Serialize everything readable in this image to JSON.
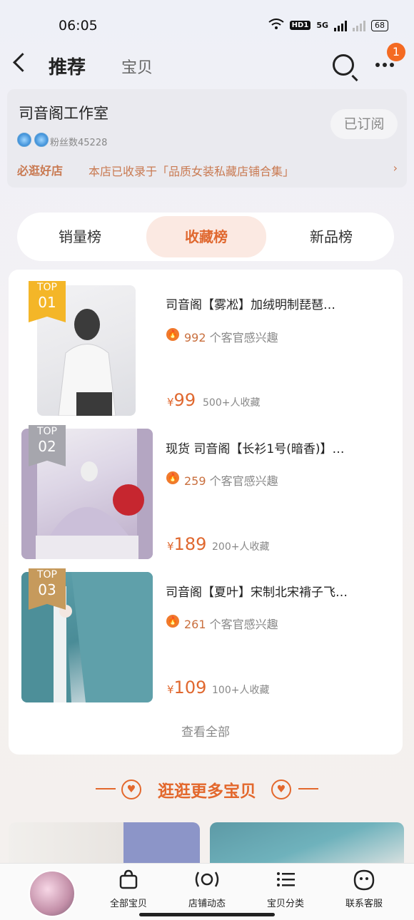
{
  "status": {
    "time": "06:05",
    "hd": "HD1",
    "net": "5G",
    "battery": "68"
  },
  "header": {
    "tab_active": "推荐",
    "tab_inactive": "宝贝",
    "badge": "1"
  },
  "shop": {
    "name": "司音阁工作室",
    "subscribe_label": "已订阅",
    "fans": "粉丝数45228",
    "must_tag": "必逛好店",
    "must_text": "本店已收录于「品质女装私藏店铺合集」",
    "arrow": "›"
  },
  "rank_tabs": [
    "销量榜",
    "收藏榜",
    "新品榜"
  ],
  "items": [
    {
      "top": "TOP",
      "rank": "01",
      "title": "司音阁【雾凇】加绒明制琵琶…",
      "interest_num": "992",
      "interest_text": "个客官感兴趣",
      "currency": "¥",
      "price": "99",
      "collect": "500+人收藏"
    },
    {
      "top": "TOP",
      "rank": "02",
      "title": "现货 司音阁【长衫1号(暗香)】…",
      "interest_num": "259",
      "interest_text": "个客官感兴趣",
      "currency": "¥",
      "price": "189",
      "collect": "200+人收藏"
    },
    {
      "top": "TOP",
      "rank": "03",
      "title": "司音阁【夏叶】宋制北宋褙子飞…",
      "interest_num": "261",
      "interest_text": "个客官感兴趣",
      "currency": "¥",
      "price": "109",
      "collect": "100+人收藏"
    }
  ],
  "see_all": "查看全部",
  "more_title": "逛逛更多宝贝",
  "bottom_nav": [
    {
      "label": "全部宝贝",
      "icon": "bag-icon"
    },
    {
      "label": "店铺动态",
      "icon": "broadcast-icon"
    },
    {
      "label": "宝贝分类",
      "icon": "list-icon"
    },
    {
      "label": "联系客服",
      "icon": "chat-icon"
    }
  ],
  "colors": {
    "accent": "#e0682f",
    "gold": "#f4b628",
    "silver": "#a6a6ad",
    "bronze": "#c69a5c"
  }
}
